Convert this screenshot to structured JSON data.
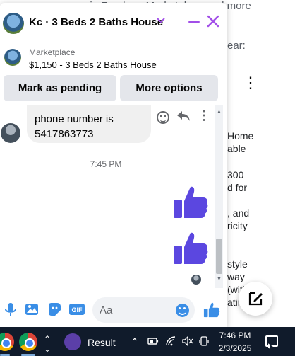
{
  "background": {
    "top_text": "may appear in Feed, on Marketplace and more",
    "ear_text": "ear:",
    "side_lines": [
      "Home",
      "able",
      "300",
      "d for",
      ", and",
      "ricity",
      "style",
      "way",
      "(with",
      "atin"
    ]
  },
  "chat": {
    "title": "Kc · 3 Beds 2 Baths House",
    "listing": {
      "label": "Marketplace",
      "price_title": "$1,150 - 3 Beds 2 Baths House"
    },
    "actions": {
      "mark_pending": "Mark as pending",
      "more_options": "More options"
    },
    "messages": [
      {
        "lines": [
          "phone number is",
          "5417863773"
        ]
      }
    ],
    "timestamp": "7:45 PM",
    "composer": {
      "placeholder": "Aa"
    },
    "accent_color": "#a24fe8",
    "like_color": "#5b47e0"
  },
  "taskbar": {
    "result_label": "Result",
    "time": "7:46 PM",
    "date": "2/3/2025"
  }
}
